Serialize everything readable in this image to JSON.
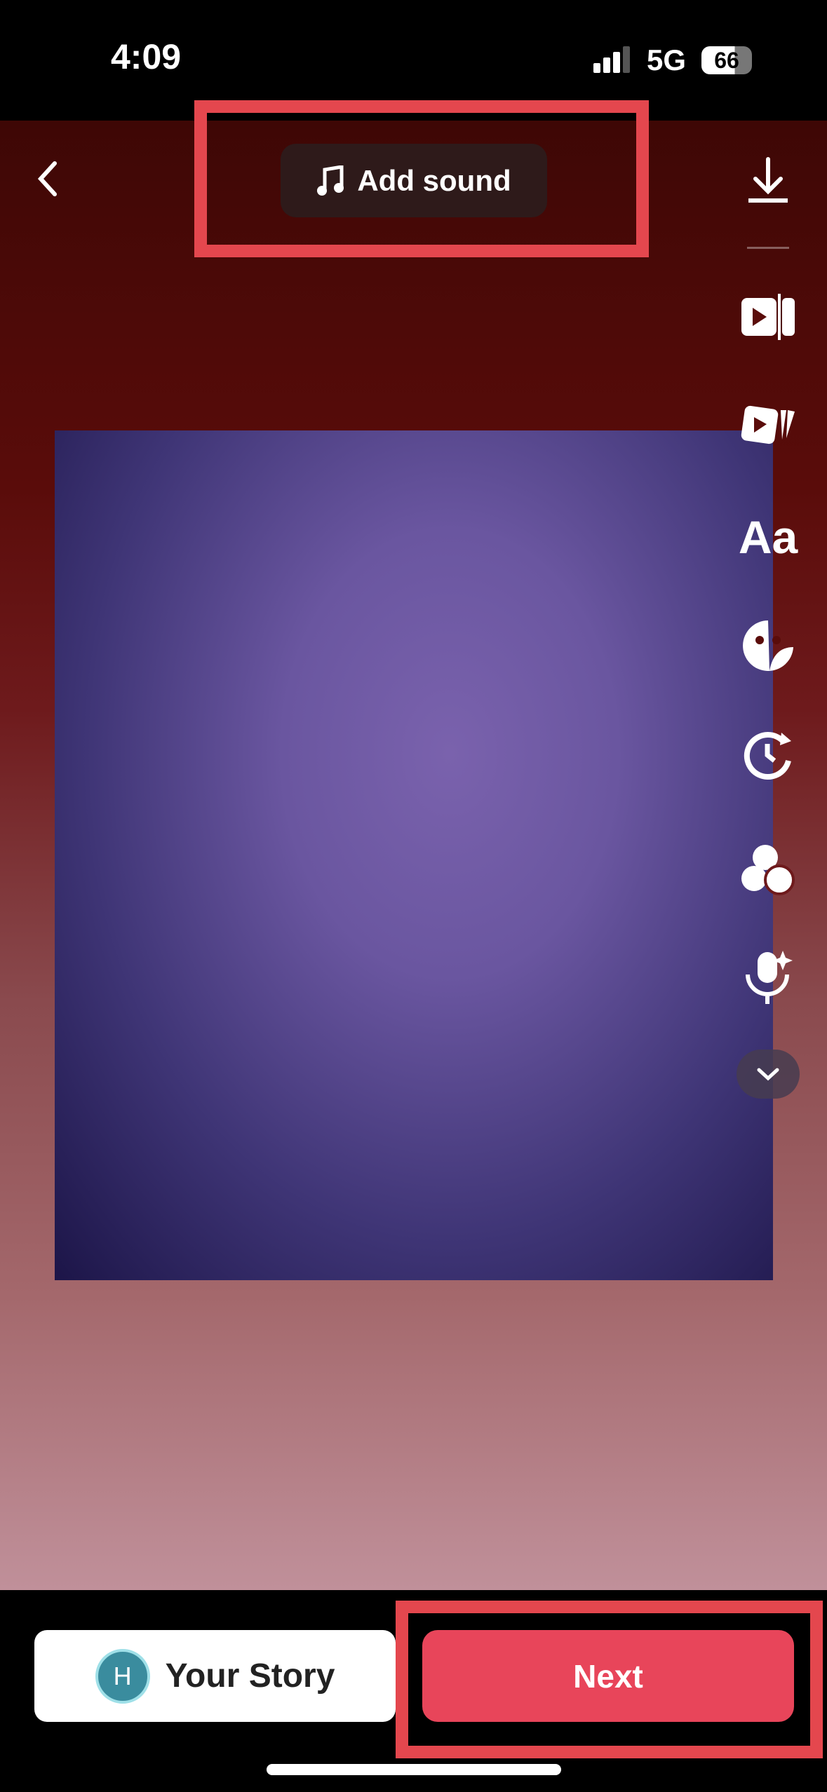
{
  "status_bar": {
    "time": "4:09",
    "network": "5G",
    "battery": "66",
    "signal_bars": 3
  },
  "top_bar": {
    "back_icon": "chevron-left",
    "add_sound_label": "Add sound",
    "music_icon": "music-note"
  },
  "toolbar": {
    "items": [
      "download",
      "video-template",
      "clips",
      "text",
      "sticker",
      "timer",
      "filters",
      "voice-effects",
      "more"
    ],
    "text_label": "Aa"
  },
  "bottom": {
    "your_story_label": "Your Story",
    "avatar_letter": "H",
    "next_label": "Next"
  },
  "colors": {
    "accent": "#e8455a",
    "annotation": "#e4474e",
    "avatar": "#3a8c9e"
  }
}
